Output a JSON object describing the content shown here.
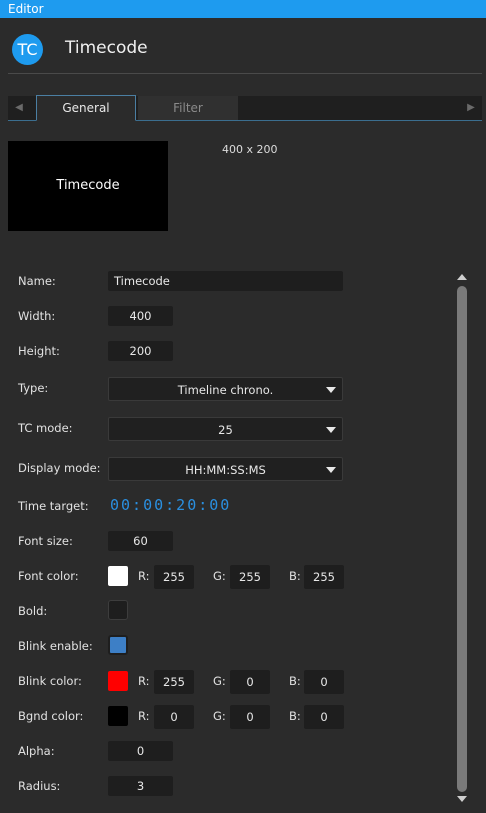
{
  "window": {
    "title": "Editor"
  },
  "header": {
    "badge": "TC",
    "title": "Timecode"
  },
  "tabs": {
    "general": "General",
    "filter": "Filter"
  },
  "preview": {
    "text": "Timecode",
    "size": "400 x 200"
  },
  "form": {
    "name": {
      "label": "Name:",
      "value": "Timecode"
    },
    "width": {
      "label": "Width:",
      "value": "400"
    },
    "height": {
      "label": "Height:",
      "value": "200"
    },
    "type": {
      "label": "Type:",
      "value": "Timeline chrono."
    },
    "tc_mode": {
      "label": "TC mode:",
      "value": "25"
    },
    "display_mode": {
      "label": "Display mode:",
      "value": "HH:MM:SS:MS"
    },
    "time_target": {
      "label": "Time target:",
      "value": "00:00:20:00"
    },
    "font_size": {
      "label": "Font size:",
      "value": "60"
    },
    "font_color": {
      "label": "Font color:",
      "r": "255",
      "g": "255",
      "b": "255",
      "swatch": "#ffffff"
    },
    "bold": {
      "label": "Bold:",
      "checked": false
    },
    "blink_enable": {
      "label": "Blink enable:",
      "checked": true
    },
    "blink_color": {
      "label": "Blink color:",
      "r": "255",
      "g": "0",
      "b": "0",
      "swatch": "#ff0000"
    },
    "bgnd_color": {
      "label": "Bgnd color:",
      "r": "0",
      "g": "0",
      "b": "0",
      "swatch": "#000000"
    },
    "alpha": {
      "label": "Alpha:",
      "value": "0"
    },
    "radius": {
      "label": "Radius:",
      "value": "3"
    },
    "channel_labels": {
      "r": "R:",
      "g": "G:",
      "b": "B:"
    }
  },
  "colors": {
    "accent": "#1e9bef",
    "digital": "#2a8fe0",
    "checkbox_on": "#3d7fc6"
  }
}
